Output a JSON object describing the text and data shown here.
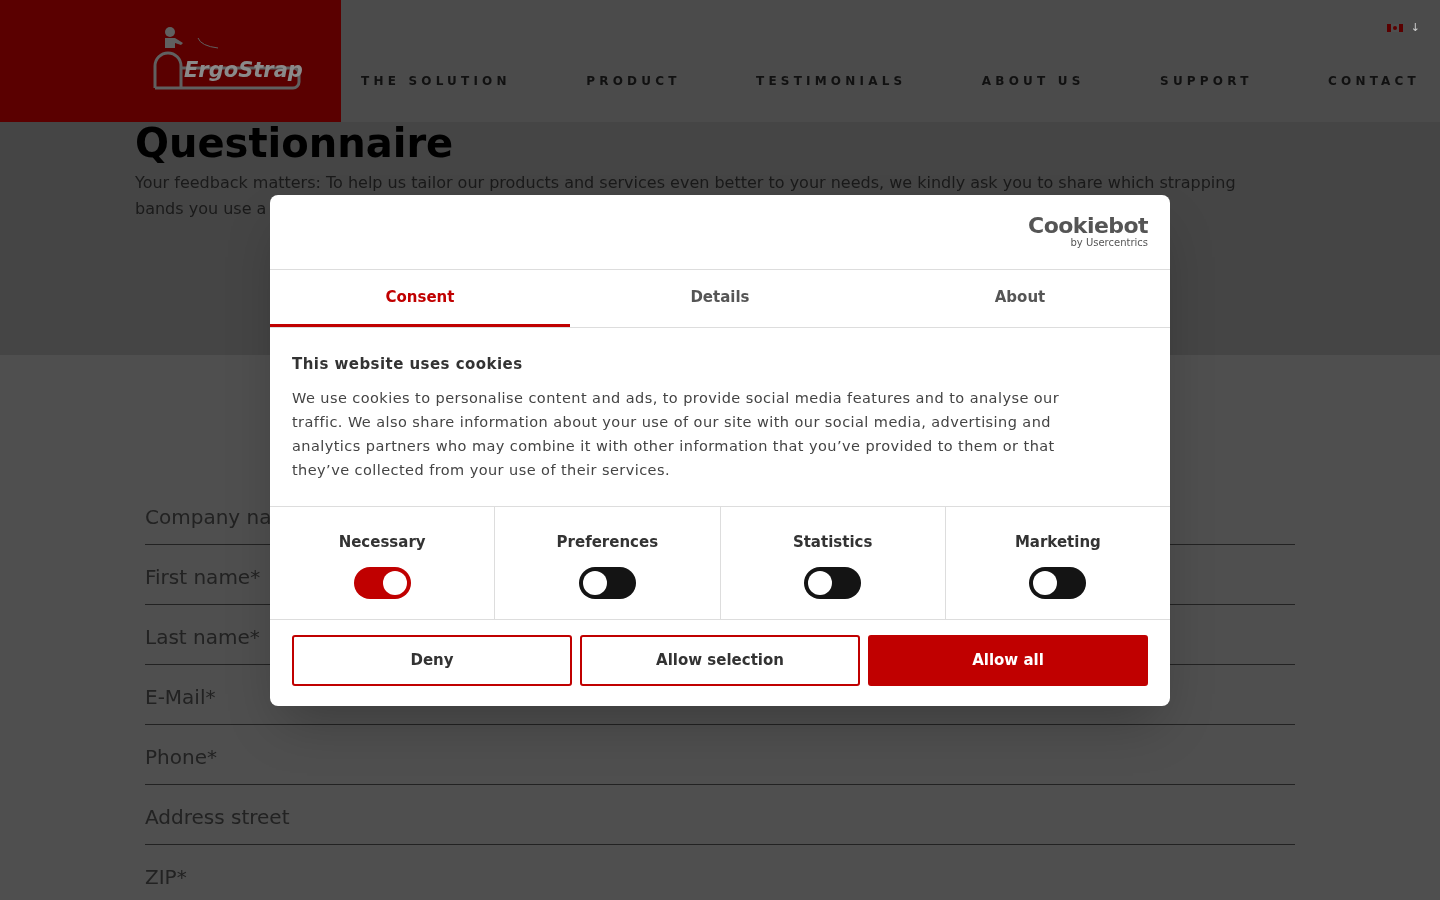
{
  "header": {
    "logo_text": "ErgoStrap",
    "nav": [
      {
        "label": "THE SOLUTION"
      },
      {
        "label": "PRODUCT"
      },
      {
        "label": "TESTIMONIALS"
      },
      {
        "label": "ABOUT US"
      },
      {
        "label": "SUPPORT"
      },
      {
        "label": "CONTACT"
      }
    ],
    "language": {
      "arrow": "↓"
    }
  },
  "page": {
    "title": "Questionnaire",
    "intro_lines": [
      "Your feedback matters: To help us tailor our products and services even better to your needs, we kindly ask you to share which strapping",
      "bands you use a"
    ],
    "fields": [
      {
        "placeholder": "Company na"
      },
      {
        "placeholder": "First name*"
      },
      {
        "placeholder": "Last name*"
      },
      {
        "placeholder": "E-Mail*"
      },
      {
        "placeholder": "Phone*"
      },
      {
        "placeholder": "Address street"
      },
      {
        "placeholder": "ZIP*"
      }
    ]
  },
  "cookie_dialog": {
    "brand": "Cookiebot",
    "brand_sub": "by Usercentrics",
    "tabs": [
      {
        "label": "Consent",
        "selected": true
      },
      {
        "label": "Details",
        "selected": false
      },
      {
        "label": "About",
        "selected": false
      }
    ],
    "heading": "This website uses cookies",
    "body": "We use cookies to personalise content and ads, to provide social media features and to analyse our traffic. We also share information about your use of our site with our social media, advertising and analytics partners who may combine it with other information that you’ve provided to them or that they’ve collected from your use of their services.",
    "categories": [
      {
        "label": "Necessary",
        "on": true
      },
      {
        "label": "Preferences",
        "on": false
      },
      {
        "label": "Statistics",
        "on": false
      },
      {
        "label": "Marketing",
        "on": false
      }
    ],
    "buttons": [
      {
        "label": "Deny",
        "kind": "outline"
      },
      {
        "label": "Allow selection",
        "kind": "outline"
      },
      {
        "label": "Allow all",
        "kind": "primary"
      }
    ]
  }
}
